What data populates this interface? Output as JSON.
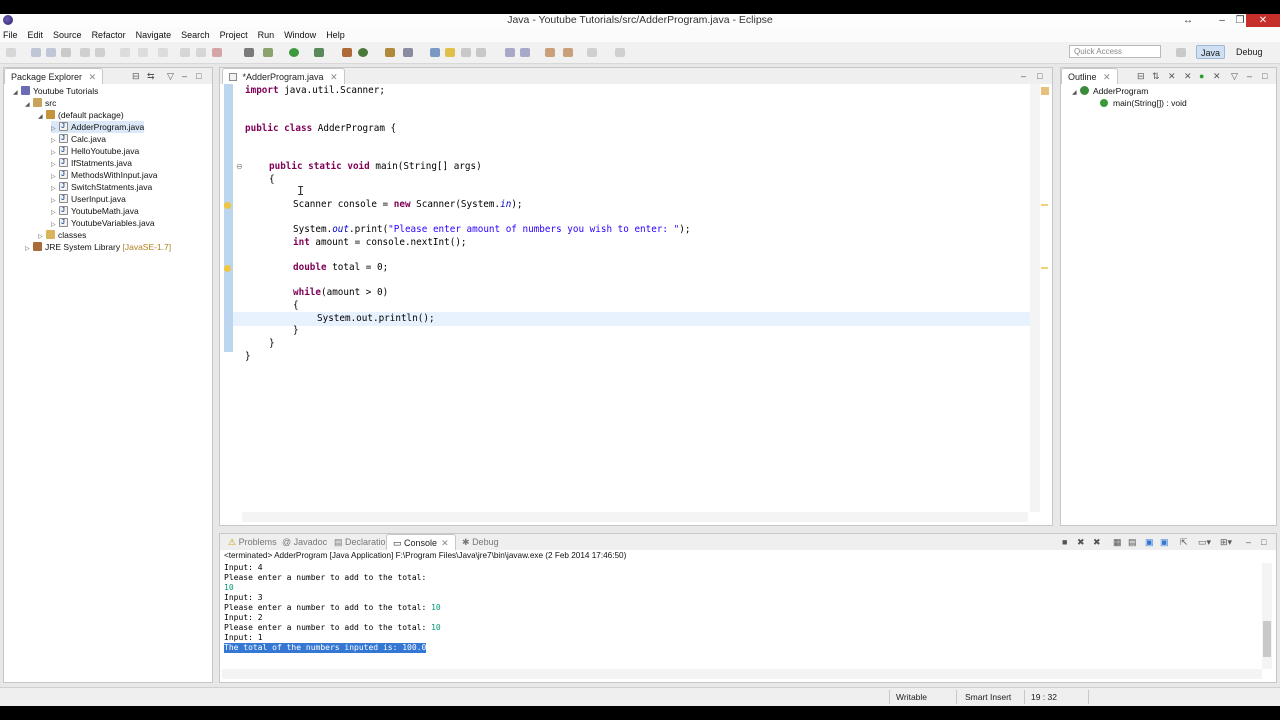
{
  "window": {
    "title": "Java - Youtube Tutorials/src/AdderProgram.java - Eclipse"
  },
  "menu": [
    "File",
    "Edit",
    "Source",
    "Refactor",
    "Navigate",
    "Search",
    "Project",
    "Run",
    "Window",
    "Help"
  ],
  "toolbar": {
    "quick_access_placeholder": "Quick Access",
    "perspective_java": "Java",
    "perspective_debug": "Debug"
  },
  "package_explorer": {
    "title": "Package Explorer",
    "items": [
      "Youtube Tutorials",
      "src",
      "(default package)",
      "AdderProgram.java",
      "Calc.java",
      "HelloYoutube.java",
      "IfStatments.java",
      "MethodsWithInput.java",
      "SwitchStatments.java",
      "UserInput.java",
      "YoutubeMath.java",
      "YoutubeVariables.java",
      "classes",
      "JRE System Library"
    ],
    "jre_suffix": "[JavaSE-1.7]"
  },
  "editor": {
    "tab_label": "*AdderProgram.java",
    "code": {
      "l1_kw": "import",
      "l1_rest": " java.util.Scanner;",
      "l2_kw": "public class",
      "l2_rest": " AdderProgram {",
      "l3_kw": "public static void",
      "l3_rest": " main(String[] args)",
      "l4": "{",
      "l5_pre": "Scanner console = ",
      "l5_kw": "new",
      "l5_mid": " Scanner(System.",
      "l5_fld": "in",
      "l5_post": ");",
      "l6_pre": "System.",
      "l6_fld": "out",
      "l6_mid": ".print(",
      "l6_str": "\"Please enter amount of numbers you wish to enter: \"",
      "l6_post": ");",
      "l7_kw": "int",
      "l7_rest": " amount = console.nextInt();",
      "l8_kw": "double",
      "l8_rest": " total = 0;",
      "l9_kw": "while",
      "l9_rest": "(amount > 0)",
      "l10": "{",
      "l11": "System.out.println();",
      "l12": "}",
      "l13": "}",
      "l14": "}"
    }
  },
  "outline": {
    "title": "Outline",
    "class_name": "AdderProgram",
    "method": "main(String[]) : void"
  },
  "bottom_tabs": [
    "Problems",
    "Javadoc",
    "Declaration",
    "Console",
    "Debug"
  ],
  "console": {
    "header": "<terminated> AdderProgram [Java Application] F:\\Program Files\\Java\\jre7\\bin\\javaw.exe (2 Feb 2014 17:46:50)",
    "lines": [
      "Input: 4",
      "Please enter a number to add to the total:",
      "10",
      "Input: 3",
      "Please enter a number to add to the total: ",
      "10",
      "Input: 2",
      "Please enter a number to add to the total: ",
      "10",
      "Input: 1",
      "The total of the numbers inputed is: 100.0"
    ]
  },
  "status": {
    "writable": "Writable",
    "insert_mode": "Smart Insert",
    "position": "19 : 32"
  },
  "colors": {
    "accent": "#3478d4",
    "keyword": "#7f0055",
    "string": "#2a00ff",
    "console_input": "#009a78"
  }
}
